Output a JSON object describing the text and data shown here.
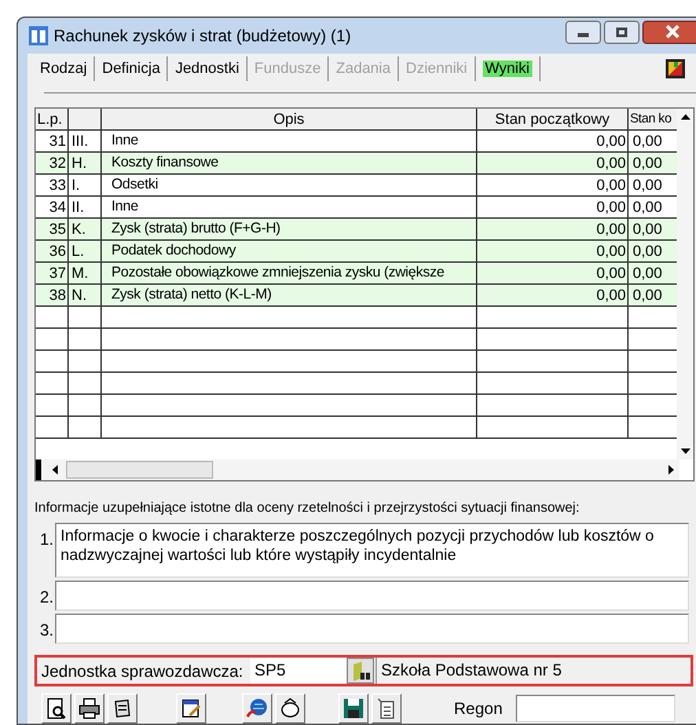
{
  "window": {
    "title": "Rachunek zysków i strat (budżetowy) (1)"
  },
  "tabs": [
    {
      "label": "Rodzaj",
      "disabled": false,
      "selected": false
    },
    {
      "label": "Definicja",
      "disabled": false,
      "selected": false
    },
    {
      "label": "Jednostki",
      "disabled": false,
      "selected": false
    },
    {
      "label": "Fundusze",
      "disabled": true,
      "selected": false
    },
    {
      "label": "Zadania",
      "disabled": true,
      "selected": false
    },
    {
      "label": "Dzienniki",
      "disabled": true,
      "selected": false
    },
    {
      "label": "Wyniki",
      "disabled": false,
      "selected": true
    }
  ],
  "table": {
    "columns": [
      "L.p.",
      "Opis",
      "Stan początkowy",
      "Stan ko"
    ],
    "rows": [
      {
        "lp": "31",
        "symbol": "III.",
        "opis": "Inne",
        "start": "0,00",
        "end": "0,00",
        "highlighted": false
      },
      {
        "lp": "32",
        "symbol": "H.",
        "opis": "Koszty finansowe",
        "start": "0,00",
        "end": "0,00",
        "highlighted": true
      },
      {
        "lp": "33",
        "symbol": "I.",
        "opis": "Odsetki",
        "start": "0,00",
        "end": "0,00",
        "highlighted": false
      },
      {
        "lp": "34",
        "symbol": "II.",
        "opis": "Inne",
        "start": "0,00",
        "end": "0,00",
        "highlighted": false
      },
      {
        "lp": "35",
        "symbol": "K.",
        "opis": "Zysk (strata) brutto (F+G-H)",
        "start": "0,00",
        "end": "0,00",
        "highlighted": true
      },
      {
        "lp": "36",
        "symbol": "L.",
        "opis": "Podatek dochodowy",
        "start": "0,00",
        "end": "0,00",
        "highlighted": true
      },
      {
        "lp": "37",
        "symbol": "M.",
        "opis": "Pozostałe obowiązkowe zmniejszenia zysku (zwiększe",
        "start": "0,00",
        "end": "0,00",
        "highlighted": true
      },
      {
        "lp": "38",
        "symbol": "N.",
        "opis": "Zysk (strata) netto (K-L-M)",
        "start": "0,00",
        "end": "0,00",
        "highlighted": true
      }
    ]
  },
  "info": {
    "heading": "Informacje uzupełniające istotne dla oceny rzetelności i przejrzystości sytuacji finansowej:",
    "items": [
      {
        "number": "1.",
        "value": "Informacje o kwocie i charakterze poszczególnych pozycji przychodów lub kosztów o nadzwyczajnej wartości lub które wystąpiły incydentalnie"
      },
      {
        "number": "2."
      },
      {
        "number": "3."
      }
    ]
  },
  "unit": {
    "label": "Jednostka sprawozdawcza:",
    "code": "SP5",
    "name": "Szkoła Podstawowa nr 5"
  },
  "regon": {
    "label": "Regon"
  }
}
